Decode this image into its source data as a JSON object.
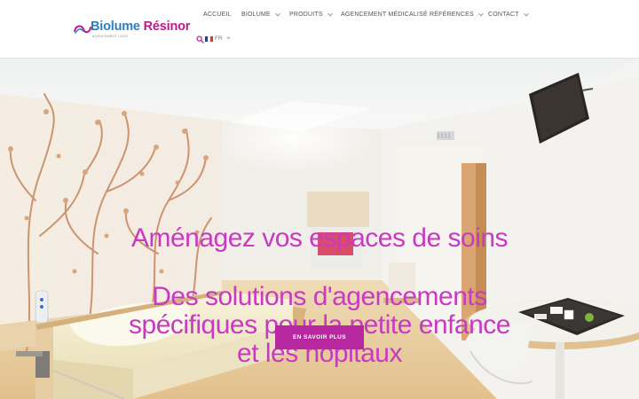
{
  "brand": {
    "name_part1": "Biolume",
    "name_part2": "Résinor",
    "tagline": "AGENCEMENT LOGO",
    "colors": {
      "blue": "#2b7fc1",
      "magenta": "#c0178f"
    }
  },
  "nav": {
    "items": [
      {
        "label": "ACCUEIL",
        "has_dropdown": false
      },
      {
        "label": "BIOLUME",
        "has_dropdown": true
      },
      {
        "label": "PRODUITS",
        "has_dropdown": true
      },
      {
        "label": "AGENCEMENT MÉDICALISÉ",
        "has_dropdown": false
      },
      {
        "label": "RÉFÉRENCES",
        "has_dropdown": true
      },
      {
        "label": "CONTACT",
        "has_dropdown": true
      }
    ],
    "search_icon": "search-icon",
    "language": {
      "label": "FR",
      "flag": "france-flag"
    }
  },
  "hero": {
    "headline_1": "Aménagez vos espaces de soins",
    "headline_2_line1": "Des solutions d'agencements",
    "headline_2_line2": "spécifiques pour la petite enfance",
    "headline_2_line3": "et les hôpitaux",
    "cta_label": "EN SAVOIR PLUS",
    "colors": {
      "headline": "#c83ac0",
      "cta": "#b7279f"
    }
  }
}
